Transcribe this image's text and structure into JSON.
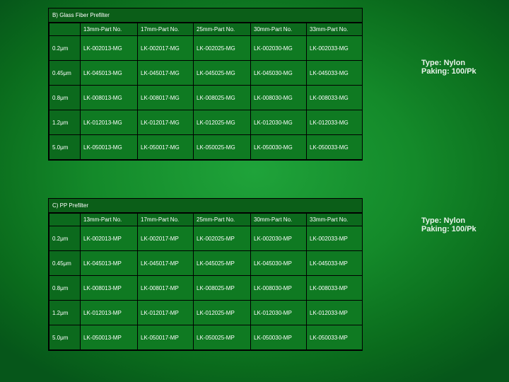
{
  "colors": {
    "background": "#148a2a",
    "cell": "#0f7a22",
    "border": "#000000",
    "text": "#ffffff"
  },
  "section_b": {
    "title": "B) Glass Fiber Prefilter",
    "headers": [
      "",
      "13mm-Part No.",
      "17mm-Part No.",
      "25mm-Part No.",
      "30mm-Part No.",
      "33mm-Part No."
    ],
    "rows": [
      [
        "0.2μm",
        "LK-002013-MG",
        "LK-002017-MG",
        "LK-002025-MG",
        "LK-002030-MG",
        "LK-002033-MG"
      ],
      [
        "0.45μm",
        "LK-045013-MG",
        "LK-045017-MG",
        "LK-045025-MG",
        "LK-045030-MG",
        "LK-045033-MG"
      ],
      [
        "0.8μm",
        "LK-008013-MG",
        "LK-008017-MG",
        "LK-008025-MG",
        "LK-008030-MG",
        "LK-008033-MG"
      ],
      [
        "1.2μm",
        "LK-012013-MG",
        "LK-012017-MG",
        "LK-012025-MG",
        "LK-012030-MG",
        "LK-012033-MG"
      ],
      [
        "5.0μm",
        "LK-050013-MG",
        "LK-050017-MG",
        "LK-050025-MG",
        "LK-050030-MG",
        "LK-050033-MG"
      ]
    ],
    "note_type": "Type: Nylon",
    "note_packing": "Paking: 100/Pk"
  },
  "section_c": {
    "title": "C) PP Prefilter",
    "headers": [
      "",
      "13mm-Part No.",
      "17mm-Part No.",
      "25mm-Part No.",
      "30mm-Part No.",
      "33mm-Part No."
    ],
    "rows": [
      [
        "0.2μm",
        "LK-002013-MP",
        "LK-002017-MP",
        "LK-002025-MP",
        "LK-002030-MP",
        "LK-002033-MP"
      ],
      [
        "0.45μm",
        "LK-045013-MP",
        "LK-045017-MP",
        "LK-045025-MP",
        "LK-045030-MP",
        "LK-045033-MP"
      ],
      [
        "0.8μm",
        "LK-008013-MP",
        "LK-008017-MP",
        "LK-008025-MP",
        "LK-008030-MP",
        "LK-008033-MP"
      ],
      [
        "1.2μm",
        "LK-012013-MP",
        "LK-012017-MP",
        "LK-012025-MP",
        "LK-012030-MP",
        "LK-012033-MP"
      ],
      [
        "5.0μm",
        "LK-050013-MP",
        "LK-050017-MP",
        "LK-050025-MP",
        "LK-050030-MP",
        "LK-050033-MP"
      ]
    ],
    "note_type": "Type: Nylon",
    "note_packing": "Paking: 100/Pk"
  }
}
